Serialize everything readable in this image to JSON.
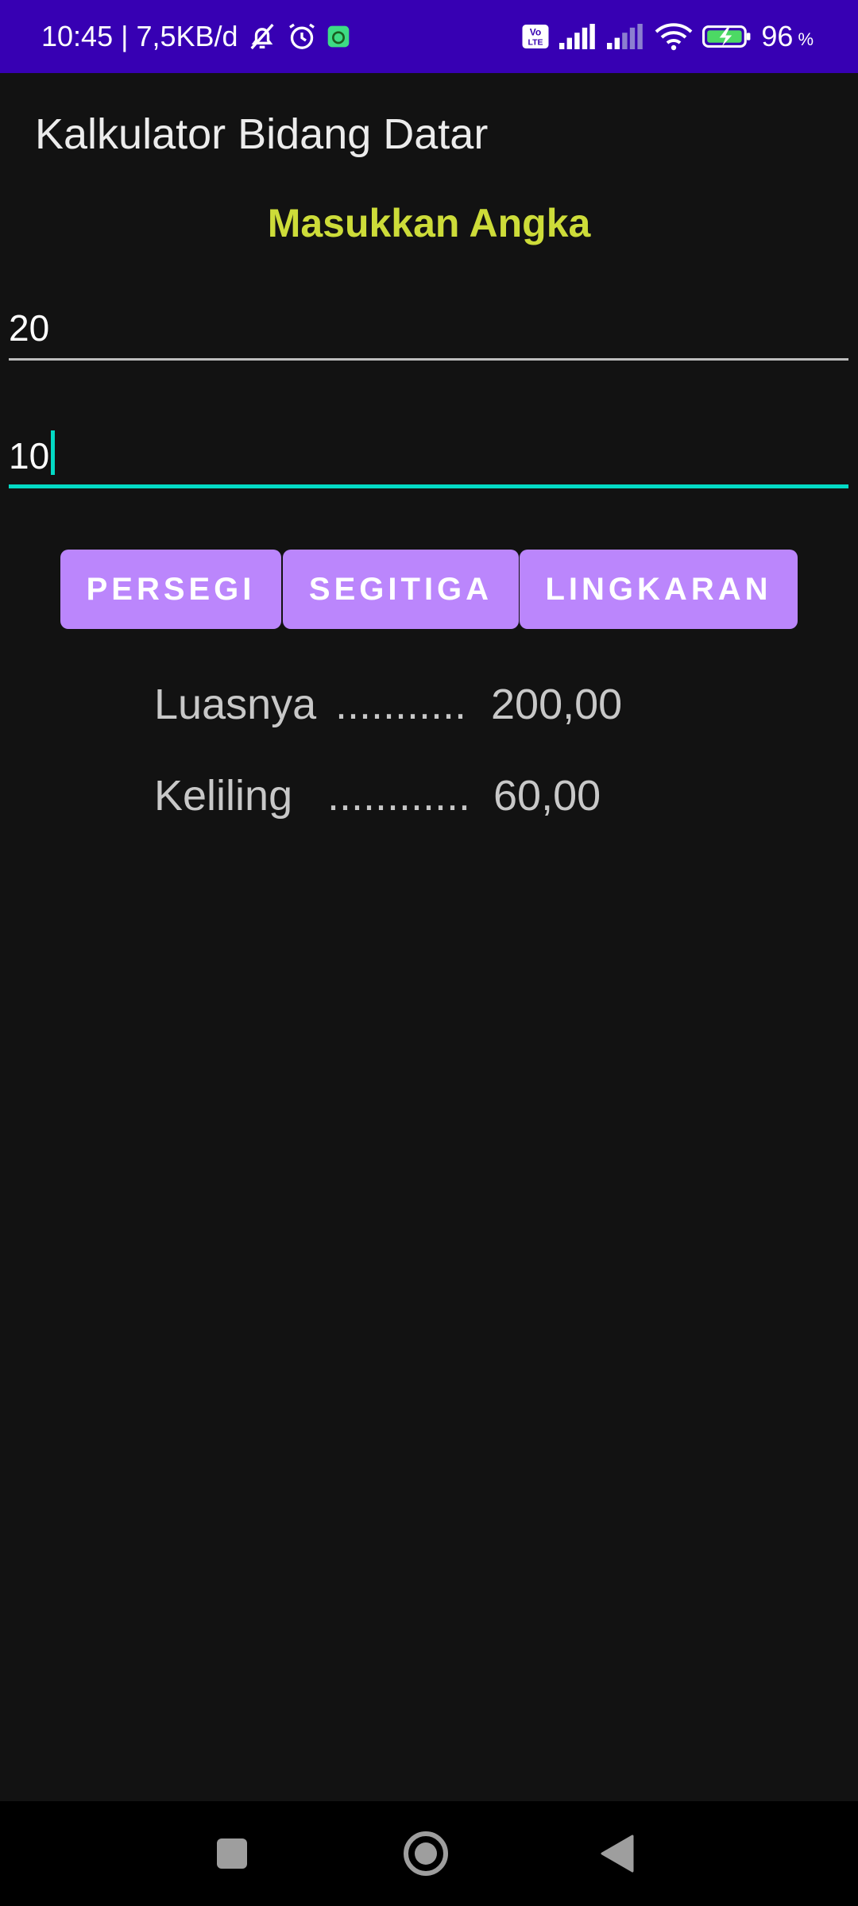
{
  "status_bar": {
    "time": "10:45",
    "separator": "|",
    "net_speed": "7,5KB/d",
    "battery_percent": "96",
    "battery_unit": "%",
    "background_color": "#3700B3",
    "icons": [
      "notifications-off-icon",
      "alarm-icon",
      "app-notification-icon",
      "volte-icon",
      "signal-icon",
      "signal-weak-icon",
      "wifi-icon",
      "battery-charging-icon"
    ]
  },
  "app": {
    "title": "Kalkulator Bidang Datar",
    "heading": "Masukkan Angka",
    "heading_color": "#CDDC39"
  },
  "inputs": {
    "first_value": "20",
    "second_value": "10",
    "focus_color": "#03DAC5"
  },
  "buttons": {
    "persegi": "PERSEGI",
    "segitiga": "SEGITIGA",
    "lingkaran": "LINGKARAN",
    "color": "#BB86FC"
  },
  "results": {
    "luas_label": "Luasnya",
    "luas_dots": "...........",
    "luas_value": "200,00",
    "keliling_label": "Keliling",
    "keliling_dots": "............",
    "keliling_value": "60,00"
  },
  "nav": {
    "icons": [
      "recents-square-icon",
      "home-circle-icon",
      "back-triangle-icon"
    ]
  }
}
